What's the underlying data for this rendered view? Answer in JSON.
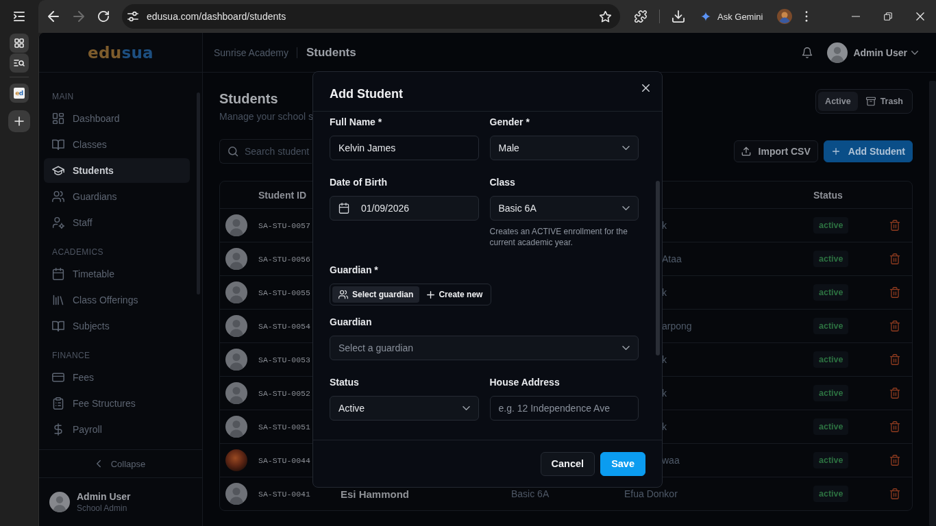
{
  "browser": {
    "back_disabled": false,
    "forward_disabled": true,
    "url": "edusua.com/dashboard/students",
    "assistant_label": "Ask Gemini"
  },
  "tab_strip": {
    "tabs": [
      {
        "favicon": [
          "e",
          "d"
        ]
      }
    ]
  },
  "sidebar": {
    "logo": [
      "edu",
      "sua"
    ],
    "sections": [
      {
        "title": "MAIN",
        "items": [
          {
            "label": "Dashboard",
            "selected": false
          },
          {
            "label": "Classes",
            "selected": false
          },
          {
            "label": "Students",
            "selected": true
          },
          {
            "label": "Guardians",
            "selected": false
          },
          {
            "label": "Staff",
            "selected": false
          }
        ]
      },
      {
        "title": "ACADEMICS",
        "items": [
          {
            "label": "Timetable",
            "selected": false
          },
          {
            "label": "Class Offerings",
            "selected": false
          },
          {
            "label": "Subjects",
            "selected": false
          }
        ]
      },
      {
        "title": "FINANCE",
        "items": [
          {
            "label": "Fees",
            "selected": false
          },
          {
            "label": "Fee Structures",
            "selected": false
          },
          {
            "label": "Payroll",
            "selected": false
          }
        ]
      }
    ],
    "collapse_label": "Collapse",
    "user": {
      "name": "Admin User",
      "role": "School Admin"
    }
  },
  "header": {
    "school": "Sunrise Academy",
    "page": "Students",
    "user_name": "Admin User"
  },
  "page": {
    "title": "Students",
    "subtitle": "Manage your school s",
    "view_toggle": [
      {
        "label": "Active",
        "selected": true
      },
      {
        "label": "Trash",
        "selected": false
      }
    ],
    "search": {
      "placeholder": "Search student"
    },
    "actions": [
      {
        "label": "Import CSV",
        "kind": "secondary"
      },
      {
        "label": "Add Student",
        "kind": "primary"
      }
    ]
  },
  "table": {
    "columns": {
      "student_id": "Student ID",
      "status": "Status"
    },
    "rows": [
      {
        "avatar": {
          "kind": "silhouette"
        },
        "student_id": "SA-STU-0057",
        "column_5": "k",
        "status": "active"
      },
      {
        "avatar": {
          "kind": "silhouette"
        },
        "student_id": "SA-STU-0056",
        "column_5": "Ataa",
        "status": "active"
      },
      {
        "avatar": {
          "kind": "silhouette"
        },
        "student_id": "SA-STU-0055",
        "column_5": "k",
        "status": "active"
      },
      {
        "avatar": {
          "kind": "silhouette"
        },
        "student_id": "SA-STU-0054",
        "column_5": "arpong",
        "status": "active"
      },
      {
        "avatar": {
          "kind": "silhouette"
        },
        "student_id": "SA-STU-0053",
        "column_5": "k",
        "status": "active"
      },
      {
        "avatar": {
          "kind": "silhouette"
        },
        "student_id": "SA-STU-0052",
        "column_5": "k",
        "status": "active"
      },
      {
        "avatar": {
          "kind": "silhouette"
        },
        "student_id": "SA-STU-0051",
        "column_5": "k",
        "status": "active"
      },
      {
        "avatar": {
          "kind": "photo"
        },
        "student_id": "SA-STU-0044",
        "column_5": "waa",
        "status": "active"
      },
      {
        "avatar": {
          "kind": "silhouette"
        },
        "student_id": "SA-STU-0041",
        "column_3": "Esi Hammond",
        "column_4": "Basic 6A",
        "column_5": "Efua Donkor",
        "status": "active"
      }
    ]
  },
  "modal": {
    "title": "Add Student",
    "rows": [
      [
        {
          "kind": "text",
          "label": "Full Name *",
          "value": "Kelvin James"
        },
        {
          "kind": "select",
          "label": "Gender *",
          "value": "Male"
        }
      ],
      [
        {
          "kind": "date",
          "label": "Date of Birth",
          "value": "01/09/2026"
        },
        {
          "kind": "select",
          "label": "Class",
          "value": "Basic 6A",
          "help": "Creates an ACTIVE enrollment for the current academic year."
        }
      ],
      [
        {
          "kind": "toggle",
          "label": "Guardian *",
          "options": [
            {
              "label": "Select guardian",
              "selected": true
            },
            {
              "label": "Create new",
              "selected": false
            }
          ]
        }
      ],
      [
        {
          "kind": "select",
          "label": "Guardian",
          "placeholder": "Select a guardian"
        }
      ],
      [
        {
          "kind": "select",
          "label": "Status",
          "value": "Active"
        },
        {
          "kind": "text",
          "label": "House Address",
          "placeholder": "e.g. 12 Independence Ave"
        }
      ]
    ],
    "buttons": [
      {
        "label": "Cancel",
        "kind": "secondary"
      },
      {
        "label": "Save",
        "kind": "primary"
      }
    ]
  }
}
